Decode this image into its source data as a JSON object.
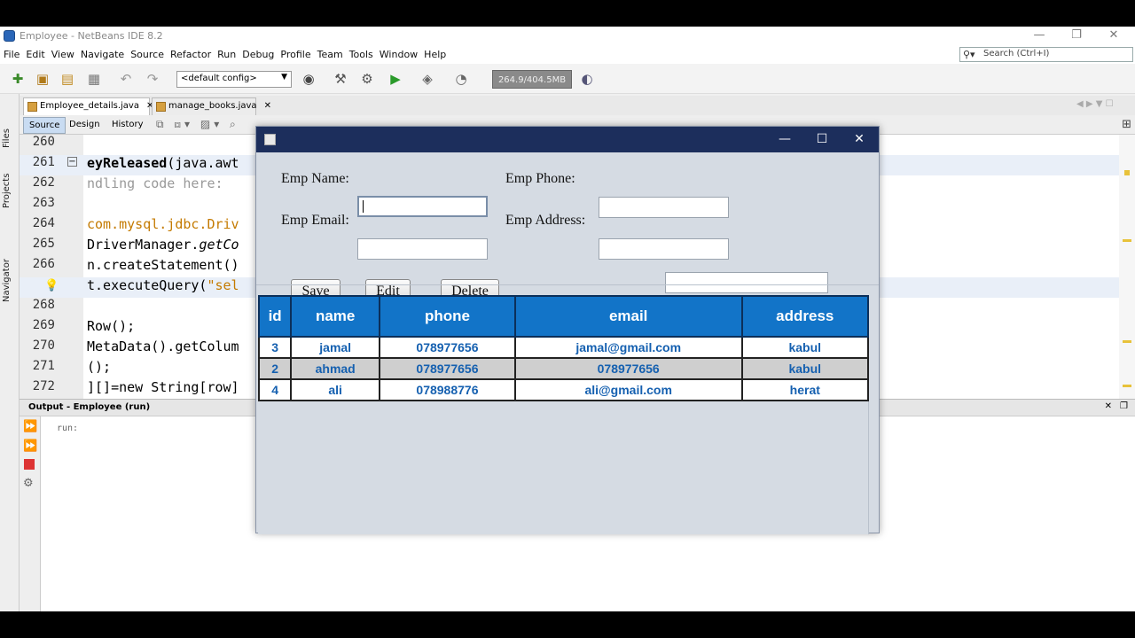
{
  "window": {
    "title": "Employee - NetBeans IDE 8.2",
    "minimize": "—",
    "restore": "❐",
    "close": "✕"
  },
  "menu": [
    "File",
    "Edit",
    "View",
    "Navigate",
    "Source",
    "Refactor",
    "Run",
    "Debug",
    "Profile",
    "Team",
    "Tools",
    "Window",
    "Help"
  ],
  "search": {
    "placeholder": "Search (Ctrl+I)"
  },
  "toolbar": {
    "config": "<default config>",
    "memory": "264.9/404.5MB"
  },
  "side_tabs": {
    "files": "Files",
    "projects": "Projects",
    "navigator": "Navigator"
  },
  "editor_tabs": [
    {
      "label": "Employee_details.java"
    },
    {
      "label": "manage_books.java"
    }
  ],
  "view_tabs": {
    "source": "Source",
    "design": "Design",
    "history": "History"
  },
  "code_lines": [
    {
      "num": "260",
      "text": ""
    },
    {
      "num": "261",
      "bold": "eyReleased",
      "rest": "(java.awt"
    },
    {
      "num": "262",
      "text": "ndling code here:"
    },
    {
      "num": "263",
      "text": ""
    },
    {
      "num": "264",
      "text": "com.mysql.jdbc.Driv"
    },
    {
      "num": "265",
      "pre": "DriverManager.",
      "italic": "getCo"
    },
    {
      "num": "266",
      "text": "n.createStatement()"
    },
    {
      "num": "",
      "pre": "t.executeQuery(",
      "str": "\"sel"
    },
    {
      "num": "268",
      "text": ""
    },
    {
      "num": "269",
      "text": "Row();"
    },
    {
      "num": "270",
      "text": "MetaData().getColum"
    },
    {
      "num": "271",
      "text": "();"
    },
    {
      "num": "272",
      "text": "][]=new String[row]"
    }
  ],
  "output": {
    "title": "Output - Employee (run)",
    "text": "run:"
  },
  "dialog": {
    "labels": {
      "emp_name": "Emp Name:",
      "emp_phone": "Emp Phone:",
      "emp_email": "Emp Email:",
      "emp_address": "Emp Address:"
    },
    "values": {
      "emp_name": "",
      "emp_phone": "",
      "emp_email": "",
      "emp_address": "",
      "search": ""
    },
    "buttons": {
      "save": "Save",
      "edit": "Edit",
      "delete": "Delete"
    },
    "table": {
      "headers": [
        "id",
        "name",
        "phone",
        "email",
        "address"
      ],
      "rows": [
        [
          "3",
          "jamal",
          "078977656",
          "jamal@gmail.com",
          "kabul"
        ],
        [
          "2",
          "ahmad",
          "078977656",
          "078977656",
          "kabul"
        ],
        [
          "4",
          "ali",
          "078988776",
          "ali@gmail.com",
          "herat"
        ]
      ]
    }
  },
  "colors": {
    "dialog_title": "#1c2e5c",
    "table_header": "#1274c8",
    "table_text": "#1560b0",
    "alt_row": "#cfcfcf"
  }
}
